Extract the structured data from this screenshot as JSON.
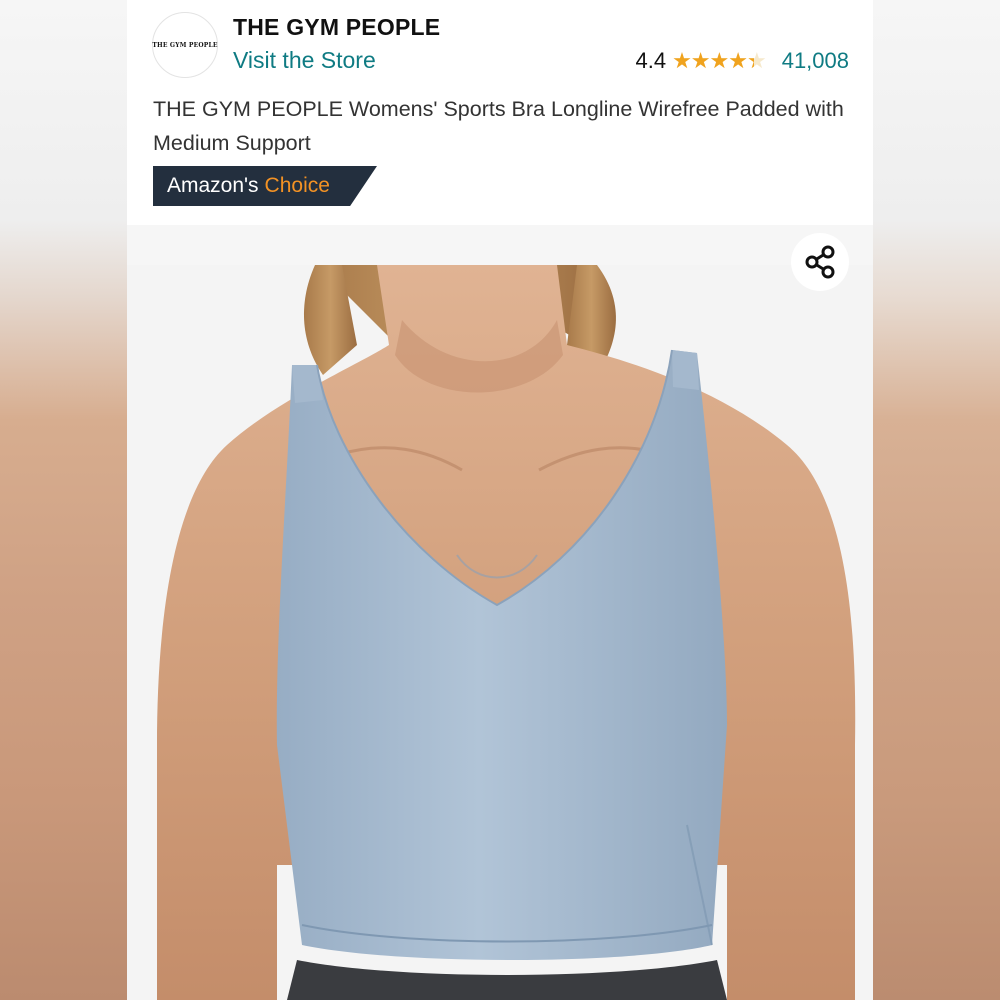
{
  "store": {
    "logo_text": "THE GYM PEOPLE",
    "brand_name": "THE GYM PEOPLE",
    "visit_link": "Visit the Store"
  },
  "rating": {
    "value": "4.4",
    "stars_out_of_5": 4.4,
    "count": "41,008"
  },
  "product": {
    "title": "THE GYM PEOPLE Womens' Sports Bra Longline Wirefree Padded with Medium Support"
  },
  "badge": {
    "prefix": "Amazon's",
    "highlight": "Choice"
  },
  "icons": {
    "share": "share-icon",
    "star": "star-icon"
  },
  "colors": {
    "link": "#0f7b83",
    "star": "#f0a31e",
    "badge_bg": "#232f3e",
    "badge_accent": "#f39224",
    "garment": "#a9bdd2"
  }
}
